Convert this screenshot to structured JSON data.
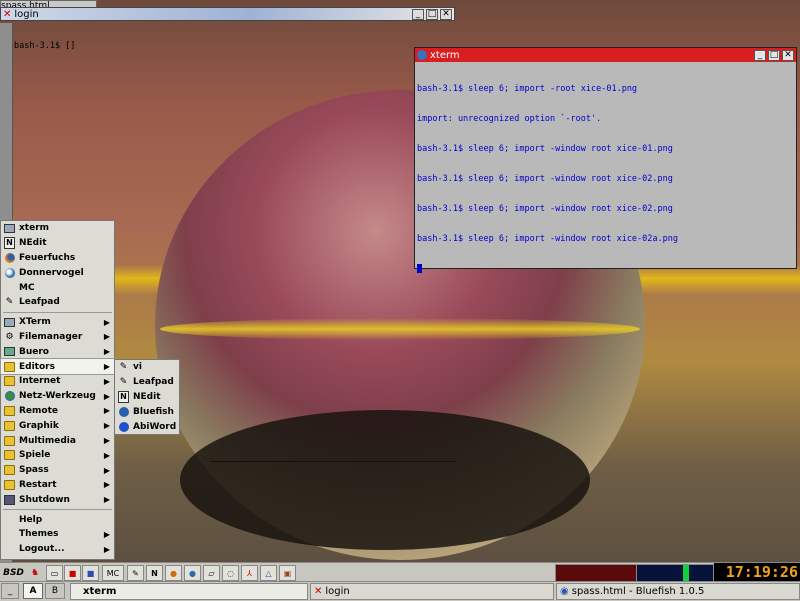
{
  "background_window": {
    "title": "spass.html"
  },
  "login_window": {
    "title": "login",
    "lines": [
      "bash-3.1$ []"
    ]
  },
  "xterm_window": {
    "title": "xterm",
    "lines": [
      "bash-3.1$ sleep 6; import -root xice-01.png",
      "import: unrecognized option `-root'.",
      "bash-3.1$ sleep 6; import -window root xice-01.png",
      "bash-3.1$ sleep 6; import -window root xice-02.png",
      "bash-3.1$ sleep 6; import -window root xice-02.png",
      "bash-3.1$ sleep 6; import -window root xice-02a.png"
    ]
  },
  "window_buttons": {
    "minimize": "_",
    "maximize": "□",
    "close": "✕"
  },
  "start_menu": {
    "apps": [
      {
        "label": "xterm",
        "icon": "monitor-icon"
      },
      {
        "label": "NEdit",
        "icon": "nedit-icon"
      },
      {
        "label": "Feuerfuchs",
        "icon": "firefox-icon"
      },
      {
        "label": "Donnervogel",
        "icon": "thunderbird-icon"
      },
      {
        "label": "MC",
        "icon": "blank"
      },
      {
        "label": "Leafpad",
        "icon": "leafpad-icon"
      }
    ],
    "categories": [
      {
        "label": "XTerm",
        "icon": "monitor-icon"
      },
      {
        "label": "Filemanager",
        "icon": "filemanager-icon"
      },
      {
        "label": "Buero",
        "icon": "office-icon"
      },
      {
        "label": "Editors",
        "icon": "folder-icon"
      },
      {
        "label": "Internet",
        "icon": "folder-icon"
      },
      {
        "label": "Netz-Werkzeug",
        "icon": "network-icon"
      },
      {
        "label": "Remote",
        "icon": "folder-icon"
      },
      {
        "label": "Graphik",
        "icon": "folder-icon"
      },
      {
        "label": "Multimedia",
        "icon": "folder-icon"
      },
      {
        "label": "Spiele",
        "icon": "folder-icon"
      },
      {
        "label": "Spass",
        "icon": "folder-icon"
      },
      {
        "label": "Restart",
        "icon": "folder-icon"
      },
      {
        "label": "Shutdown",
        "icon": "shutdown-icon"
      }
    ],
    "footer": [
      {
        "label": "Help",
        "submenu": false
      },
      {
        "label": "Themes",
        "submenu": true
      },
      {
        "label": "Logout...",
        "submenu": true
      }
    ],
    "selected": "Editors"
  },
  "editors_submenu": [
    {
      "label": "vi",
      "icon": "leafpad-icon"
    },
    {
      "label": "Leafpad",
      "icon": "leafpad-icon"
    },
    {
      "label": "NEdit",
      "icon": "nedit-icon"
    },
    {
      "label": "Bluefish",
      "icon": "bluefish-icon"
    },
    {
      "label": "AbiWord",
      "icon": "abiword-icon"
    }
  ],
  "panel": {
    "start_label": "BSD",
    "quick_launch_mc": "MC",
    "workspaces": [
      "A",
      "B"
    ],
    "active_workspace": "A",
    "tasks": [
      "xterm",
      "login",
      "spass.html - Bluefish 1.0.5"
    ],
    "clock": "17:19:26",
    "colors": {
      "accent_red": "#d81e1e",
      "clock_fg": "#f0a020",
      "term_blue": "#0000cc"
    }
  }
}
